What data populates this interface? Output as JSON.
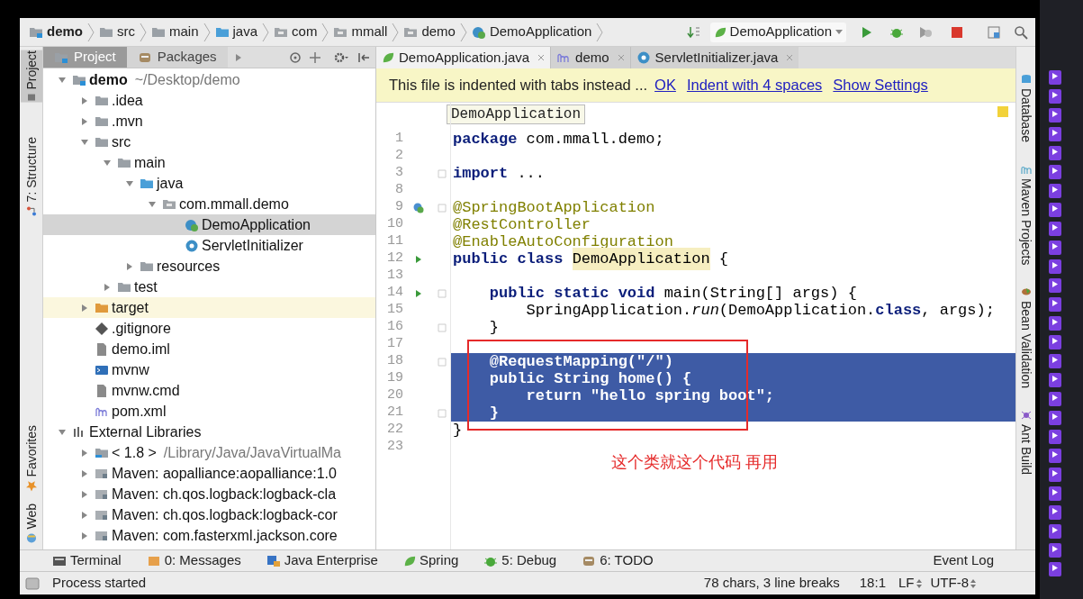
{
  "breadcrumbs": [
    {
      "label": "demo",
      "kind": "module"
    },
    {
      "label": "src",
      "kind": "folder"
    },
    {
      "label": "main",
      "kind": "folder"
    },
    {
      "label": "java",
      "kind": "source"
    },
    {
      "label": "com",
      "kind": "package"
    },
    {
      "label": "mmall",
      "kind": "package"
    },
    {
      "label": "demo",
      "kind": "package"
    },
    {
      "label": "DemoApplication",
      "kind": "spring"
    }
  ],
  "run_config": {
    "label": "DemoApplication"
  },
  "left_strip": [
    {
      "label": "Project",
      "kind": "project",
      "selected": true
    },
    {
      "label": "7: Structure",
      "kind": "structure",
      "selected": false
    },
    {
      "label": "Favorites",
      "kind": "favorites",
      "selected": false
    },
    {
      "label": "Web",
      "kind": "web",
      "selected": false
    }
  ],
  "right_strip": [
    {
      "label": "Database",
      "kind": "database"
    },
    {
      "label": "Maven Projects",
      "kind": "maven"
    },
    {
      "label": "Bean Validation",
      "kind": "bean"
    },
    {
      "label": "Ant Build",
      "kind": "ant"
    }
  ],
  "project_tabs": [
    {
      "label": "Project",
      "selected": true
    },
    {
      "label": "Packages",
      "selected": false
    }
  ],
  "tree": [
    {
      "label": "demo",
      "suffix": "~/Desktop/demo",
      "kind": "module",
      "expanded": true,
      "selected": false,
      "children": [
        {
          "label": ".idea",
          "kind": "folder",
          "expanded": false,
          "selected": false
        },
        {
          "label": ".mvn",
          "kind": "folder",
          "expanded": false,
          "selected": false
        },
        {
          "label": "src",
          "kind": "folder",
          "expanded": true,
          "selected": false,
          "children": [
            {
              "label": "main",
              "kind": "folder",
              "expanded": true,
              "selected": false,
              "children": [
                {
                  "label": "java",
                  "kind": "source",
                  "expanded": true,
                  "selected": false,
                  "children": [
                    {
                      "label": "com.mmall.demo",
                      "kind": "package",
                      "expanded": true,
                      "selected": false,
                      "children": [
                        {
                          "label": "DemoApplication",
                          "kind": "spring",
                          "selected": true
                        },
                        {
                          "label": "ServletInitializer",
                          "kind": "class",
                          "selected": false
                        }
                      ]
                    }
                  ]
                },
                {
                  "label": "resources",
                  "kind": "folder",
                  "expanded": false,
                  "selected": false
                }
              ]
            },
            {
              "label": "test",
              "kind": "folder",
              "expanded": false,
              "selected": false
            }
          ]
        },
        {
          "label": "target",
          "kind": "excluded",
          "expanded": false,
          "selected": false
        },
        {
          "label": ".gitignore",
          "kind": "git",
          "selected": false
        },
        {
          "label": "demo.iml",
          "kind": "file",
          "selected": false
        },
        {
          "label": "mvnw",
          "kind": "shell",
          "selected": false
        },
        {
          "label": "mvnw.cmd",
          "kind": "file",
          "selected": false
        },
        {
          "label": "pom.xml",
          "kind": "maven",
          "selected": false
        }
      ]
    },
    {
      "label": "External Libraries",
      "kind": "library",
      "expanded": true,
      "selected": false,
      "children": [
        {
          "label": "< 1.8 >",
          "suffix": "/Library/Java/JavaVirtualMa",
          "kind": "jdk",
          "expanded": false,
          "selected": false
        },
        {
          "label": "Maven: aopalliance:aopalliance:1.0",
          "kind": "lib",
          "expanded": false,
          "selected": false
        },
        {
          "label": "Maven: ch.qos.logback:logback-cla",
          "kind": "lib",
          "expanded": false,
          "selected": false
        },
        {
          "label": "Maven: ch.qos.logback:logback-cor",
          "kind": "lib",
          "expanded": false,
          "selected": false
        },
        {
          "label": "Maven: com.fasterxml.jackson.core",
          "kind": "lib",
          "expanded": false,
          "selected": false
        }
      ]
    }
  ],
  "editor_tabs": [
    {
      "label": "DemoApplication.java",
      "kind": "spring",
      "selected": true
    },
    {
      "label": "demo",
      "kind": "maven",
      "selected": false
    },
    {
      "label": "ServletInitializer.java",
      "kind": "class",
      "selected": false
    }
  ],
  "notification": {
    "text": "This file is indented with tabs instead ...",
    "links": [
      "OK",
      "Indent with 4 spaces",
      "Show Settings"
    ]
  },
  "hint": "DemoApplication",
  "code": [
    {
      "n": "1",
      "tokens": [
        {
          "text": "package",
          "kind": "kw"
        },
        {
          "text": " com.mmall.demo;",
          "kind": "plain"
        }
      ]
    },
    {
      "n": "2"
    },
    {
      "n": "3",
      "fold": true,
      "tokens": [
        {
          "text": "import",
          "kind": "kw"
        },
        {
          "text": " ...",
          "kind": "plain"
        }
      ]
    },
    {
      "n": "8"
    },
    {
      "n": "9",
      "gutter": {
        "kind": "bean"
      },
      "fold": true,
      "tokens": [
        {
          "text": "@SpringBootApplication",
          "kind": "anno"
        }
      ]
    },
    {
      "n": "10",
      "tokens": [
        {
          "text": "@RestController",
          "kind": "anno"
        }
      ]
    },
    {
      "n": "11",
      "tokens": [
        {
          "text": "@EnableAutoConfiguration",
          "kind": "anno"
        }
      ]
    },
    {
      "n": "12",
      "gutter": {
        "kind": "run"
      },
      "tokens": [
        {
          "text": "public class ",
          "kind": "kw"
        },
        {
          "text": "DemoApplication",
          "kind": "mark"
        },
        {
          "text": " {",
          "kind": "plain"
        }
      ]
    },
    {
      "n": "13"
    },
    {
      "n": "14",
      "gutter": {
        "kind": "run"
      },
      "fold": true,
      "tokens": [
        {
          "text": "    public static void",
          "kind": "kw"
        },
        {
          "text": " main(String[] args) {",
          "kind": "plain"
        }
      ]
    },
    {
      "n": "15",
      "tokens": [
        {
          "text": "        SpringApplication.",
          "kind": "plain"
        },
        {
          "text": "run",
          "kind": "italic"
        },
        {
          "text": "(DemoApplication.",
          "kind": "plain"
        },
        {
          "text": "class",
          "kind": "kw"
        },
        {
          "text": ", args);",
          "kind": "plain"
        }
      ]
    },
    {
      "n": "16",
      "fold": true,
      "tokens": [
        {
          "text": "    }",
          "kind": "plain"
        }
      ]
    },
    {
      "n": "17"
    },
    {
      "n": "18",
      "selected": true,
      "fold": true,
      "tokens": [
        {
          "text": "    @RequestMapping(\"/\")"
        }
      ]
    },
    {
      "n": "19",
      "selected": true,
      "tokens": [
        {
          "text": "    public String home() {"
        }
      ]
    },
    {
      "n": "20",
      "selected": true,
      "tokens": [
        {
          "text": "        return \"hello spring boot\";"
        }
      ]
    },
    {
      "n": "21",
      "selected": true,
      "fold": true,
      "tokens": [
        {
          "text": "    }"
        }
      ]
    },
    {
      "n": "22",
      "selected": false,
      "tokens": [
        {
          "text": "}",
          "kind": "plain"
        }
      ]
    },
    {
      "n": "23"
    }
  ],
  "annotation": "这个类就这个代码  再用",
  "tool_buttons": [
    {
      "label": "Terminal",
      "kind": "terminal"
    },
    {
      "label": "0: Messages",
      "kind": "messages"
    },
    {
      "label": "Java Enterprise",
      "kind": "enterprise"
    },
    {
      "label": "Spring",
      "kind": "spring"
    },
    {
      "label": "5: Debug",
      "kind": "debug"
    },
    {
      "label": "6: TODO",
      "kind": "todo"
    }
  ],
  "event_log": "Event Log",
  "status": {
    "message": "Process started",
    "selection": "78 chars, 3 line breaks",
    "position": "18:1",
    "line_sep": "LF",
    "encoding": "UTF-8"
  }
}
